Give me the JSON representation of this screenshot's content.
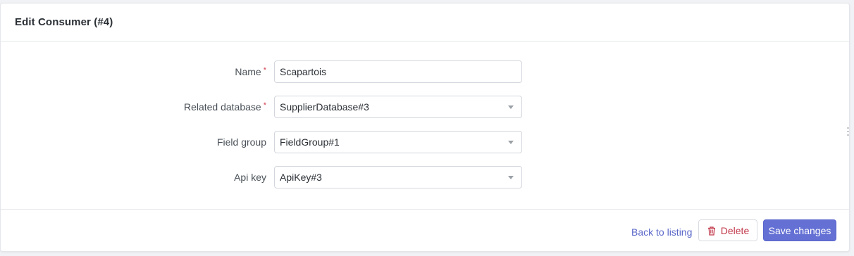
{
  "card": {
    "title": "Edit Consumer (#4)"
  },
  "form": {
    "fields": [
      {
        "label": "Name",
        "required_mark": "*",
        "value": "Scapartois"
      },
      {
        "label": "Related database",
        "required_mark": "*",
        "value": "SupplierDatabase#3"
      },
      {
        "label": "Field group",
        "value": "FieldGroup#1"
      },
      {
        "label": "Api key",
        "value": "ApiKey#3"
      }
    ]
  },
  "footer": {
    "back_label": "Back to listing",
    "delete_label": "Delete",
    "save_label": "Save changes"
  },
  "colors": {
    "primary": "#6470d4",
    "danger": "#c2394b",
    "link": "#5a67c8",
    "required": "#d43f4f"
  },
  "icons": {
    "delete": "trash-icon",
    "select_caret": "caret-down-icon"
  }
}
